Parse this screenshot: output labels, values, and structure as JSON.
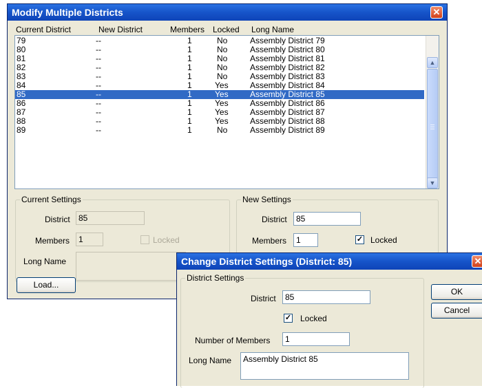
{
  "main_dialog": {
    "title": "Modify Multiple Districts",
    "columns": [
      "Current District",
      "New District",
      "Members",
      "Locked",
      "Long Name"
    ],
    "rows": [
      {
        "current": "79",
        "new": "--",
        "members": "1",
        "locked": "No",
        "long_name": "Assembly District 79"
      },
      {
        "current": "80",
        "new": "--",
        "members": "1",
        "locked": "No",
        "long_name": "Assembly District 80"
      },
      {
        "current": "81",
        "new": "--",
        "members": "1",
        "locked": "No",
        "long_name": "Assembly District 81"
      },
      {
        "current": "82",
        "new": "--",
        "members": "1",
        "locked": "No",
        "long_name": "Assembly District 82"
      },
      {
        "current": "83",
        "new": "--",
        "members": "1",
        "locked": "No",
        "long_name": "Assembly District 83"
      },
      {
        "current": "84",
        "new": "--",
        "members": "1",
        "locked": "Yes",
        "long_name": "Assembly District 84"
      },
      {
        "current": "85",
        "new": "--",
        "members": "1",
        "locked": "Yes",
        "long_name": "Assembly District 85"
      },
      {
        "current": "86",
        "new": "--",
        "members": "1",
        "locked": "Yes",
        "long_name": "Assembly District 86"
      },
      {
        "current": "87",
        "new": "--",
        "members": "1",
        "locked": "Yes",
        "long_name": "Assembly District 87"
      },
      {
        "current": "88",
        "new": "--",
        "members": "1",
        "locked": "Yes",
        "long_name": "Assembly District 88"
      },
      {
        "current": "89",
        "new": "--",
        "members": "1",
        "locked": "No",
        "long_name": "Assembly District 89"
      }
    ],
    "selected_row": 6,
    "current_settings": {
      "legend": "Current Settings",
      "district_label": "District",
      "district_value": "85",
      "members_label": "Members",
      "members_value": "1",
      "locked_label": "Locked",
      "long_name_label": "Long Name",
      "long_name_value": ""
    },
    "new_settings": {
      "legend": "New Settings",
      "district_label": "District",
      "district_value": "85",
      "members_label": "Members",
      "members_value": "1",
      "locked_label": "Locked",
      "locked_checked": true
    },
    "load_button": "Load..."
  },
  "change_dialog": {
    "title": "Change District Settings (District: 85)",
    "group_legend": "District Settings",
    "district_label": "District",
    "district_value": "85",
    "locked_label": "Locked",
    "locked_checked": true,
    "members_label": "Number of Members",
    "members_value": "1",
    "long_name_label": "Long Name",
    "long_name_value": "Assembly District 85",
    "ok_button": "OK",
    "cancel_button": "Cancel"
  },
  "icons": {
    "close": "close-icon",
    "check": "checkmark-icon",
    "scroll_up": "scroll-up-icon",
    "scroll_down": "scroll-down-icon"
  },
  "colors": {
    "titlebar": "#1654c9",
    "selection": "#316ac5",
    "dialog_bg": "#ece9d8"
  }
}
